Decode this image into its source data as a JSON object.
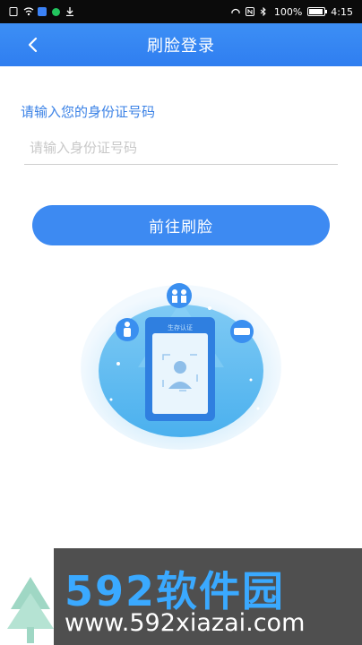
{
  "status_bar": {
    "battery": "100%",
    "time": "4:15"
  },
  "nav": {
    "title": "刷脸登录"
  },
  "form": {
    "label": "请输入您的身份证号码",
    "id_input_placeholder": "请输入身份证号码",
    "id_input_value": ""
  },
  "actions": {
    "go_face_label": "前往刷脸"
  },
  "illustration": {
    "card_title": "生存认证"
  },
  "watermark": {
    "logo": "592软件园",
    "url": "www.592xiazai.com"
  },
  "colors": {
    "primary": "#3d8af2",
    "label": "#3b82e6"
  }
}
